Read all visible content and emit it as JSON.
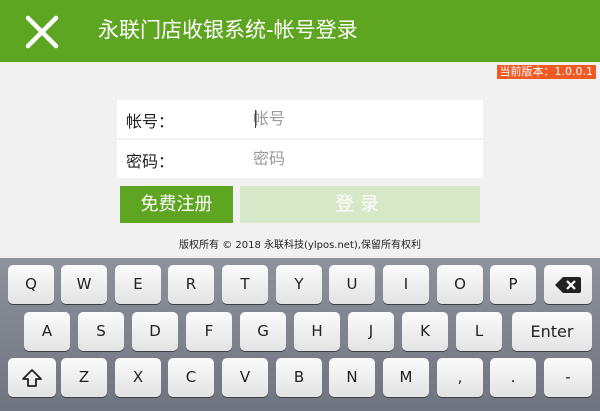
{
  "header": {
    "title": "永联门店收银系统-帐号登录",
    "close_icon": "close-icon"
  },
  "version_label": "当前版本：1.0.0.1",
  "form": {
    "account": {
      "label": "帐号：",
      "placeholder": "帐号",
      "value": ""
    },
    "password": {
      "label": "密码：",
      "placeholder": "密码",
      "value": ""
    }
  },
  "buttons": {
    "register": "免费注册",
    "login": "登录"
  },
  "copyright": "版权所有 © 2018 永联科技(ylpos.net),保留所有权利",
  "keyboard": {
    "row1": [
      "Q",
      "W",
      "E",
      "R",
      "T",
      "Y",
      "U",
      "I",
      "O",
      "P"
    ],
    "backspace_icon": "backspace-icon",
    "row2": [
      "A",
      "S",
      "D",
      "F",
      "G",
      "H",
      "J",
      "K",
      "L"
    ],
    "enter": "Enter",
    "shift_icon": "shift-icon",
    "row3": [
      "Z",
      "X",
      "C",
      "V",
      "B",
      "N",
      "M",
      ",",
      "."
    ],
    "dash": "-"
  },
  "colors": {
    "brand": "#5ea521",
    "version_badge": "#ef5a24",
    "login_disabled": "#d6e8c8"
  }
}
